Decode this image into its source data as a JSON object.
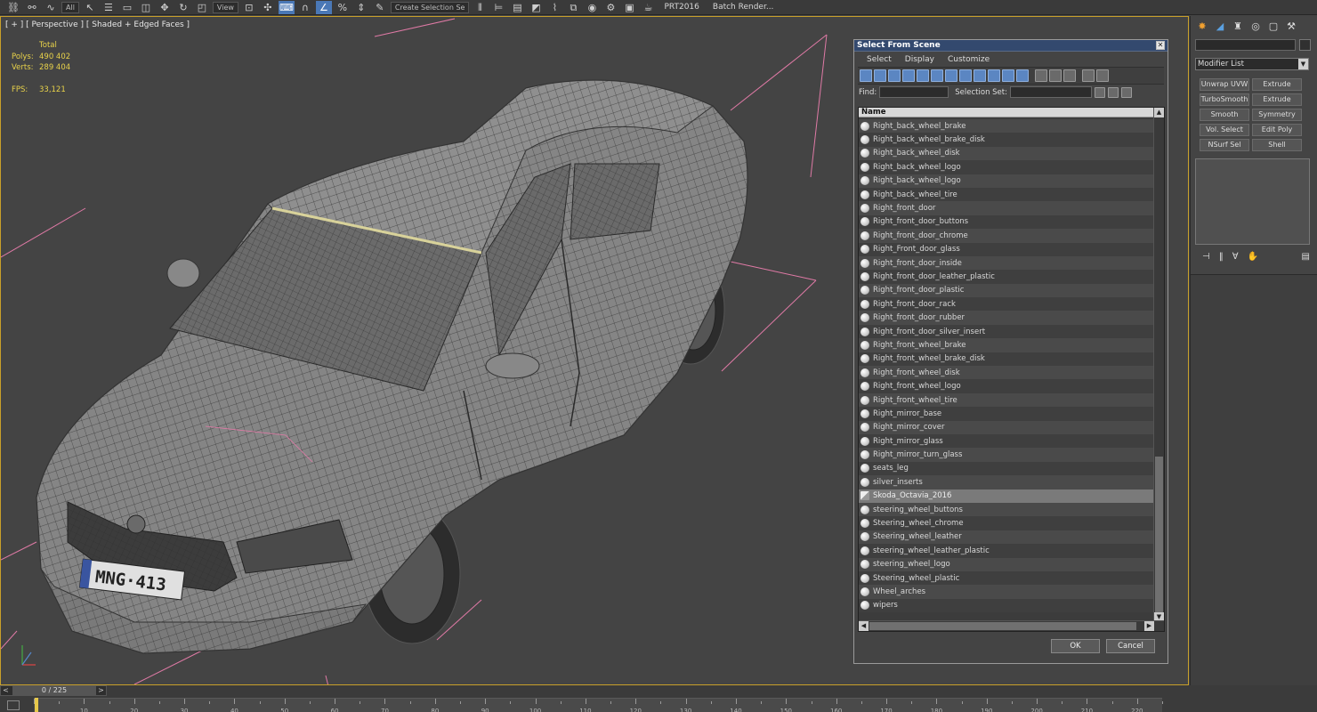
{
  "toolbar": {
    "selection_filter": "All",
    "ref_coord": "View",
    "named_selection": "Create Selection Se",
    "label_prt": "PRT2016",
    "label_batch": "Batch Render..."
  },
  "viewport": {
    "label": "[ + ] [ Perspective ] [ Shaded + Edged Faces ]",
    "stats_header": "Total",
    "polys_label": "Polys:",
    "polys_value": "490 402",
    "verts_label": "Verts:",
    "verts_value": "289 404",
    "fps_label": "FPS:",
    "fps_value": "33,121",
    "license_plate": "MNG·413"
  },
  "dialog": {
    "title": "Select From Scene",
    "menus": [
      "Select",
      "Display",
      "Customize"
    ],
    "find_label": "Find:",
    "selset_label": "Selection Set:",
    "column_name": "Name",
    "ok_label": "OK",
    "cancel_label": "Cancel",
    "items": [
      "Right_back_wheel_brake",
      "Right_back_wheel_brake_disk",
      "Right_back_wheel_disk",
      "Right_back_wheel_logo",
      "Right_back_wheel_logo",
      "Right_back_wheel_tire",
      "Right_front_door",
      "Right_front_door_buttons",
      "Right_front_door_chrome",
      "Right_Front_door_glass",
      "Right_front_door_inside",
      "Right_front_door_leather_plastic",
      "Right_front_door_plastic",
      "Right_front_door_rack",
      "Right_front_door_rubber",
      "Right_front_door_silver_insert",
      "Right_front_wheel_brake",
      "Right_front_wheel_brake_disk",
      "Right_front_wheel_disk",
      "Right_front_wheel_logo",
      "Right_front_wheel_tire",
      "Right_mirror_base",
      "Right_mirror_cover",
      "Right_mirror_glass",
      "Right_mirror_turn_glass",
      "seats_leg",
      "silver_inserts",
      "Skoda_Octavia_2016",
      "steering_wheel_buttons",
      "Steering_wheel_chrome",
      "Steering_wheel_leather",
      "steering_wheel_leather_plastic",
      "steering_wheel_logo",
      "Steering_wheel_plastic",
      "Wheel_arches",
      "wipers"
    ],
    "selected_item": "Skoda_Octavia_2016"
  },
  "command_panel": {
    "modifier_list": "Modifier List",
    "modifiers": [
      "Unwrap UVW",
      "Extrude",
      "TurboSmooth",
      "Extrude",
      "Smooth",
      "Symmetry",
      "Vol. Select",
      "Edit Poly",
      "NSurf Sel",
      "Shell"
    ]
  },
  "timeline": {
    "frame_counter": "0 / 225",
    "ticks": [
      "10",
      "20",
      "30",
      "40",
      "50",
      "60",
      "70",
      "80",
      "90",
      "100",
      "110",
      "120",
      "130",
      "140",
      "150",
      "160",
      "170",
      "180",
      "190",
      "200",
      "210",
      "220"
    ]
  },
  "colors": {
    "viewport_border": "#c8a02a",
    "stats_text": "#e8d24a",
    "dialog_title": "#33496e",
    "bounding_box": "#e07aa6"
  }
}
